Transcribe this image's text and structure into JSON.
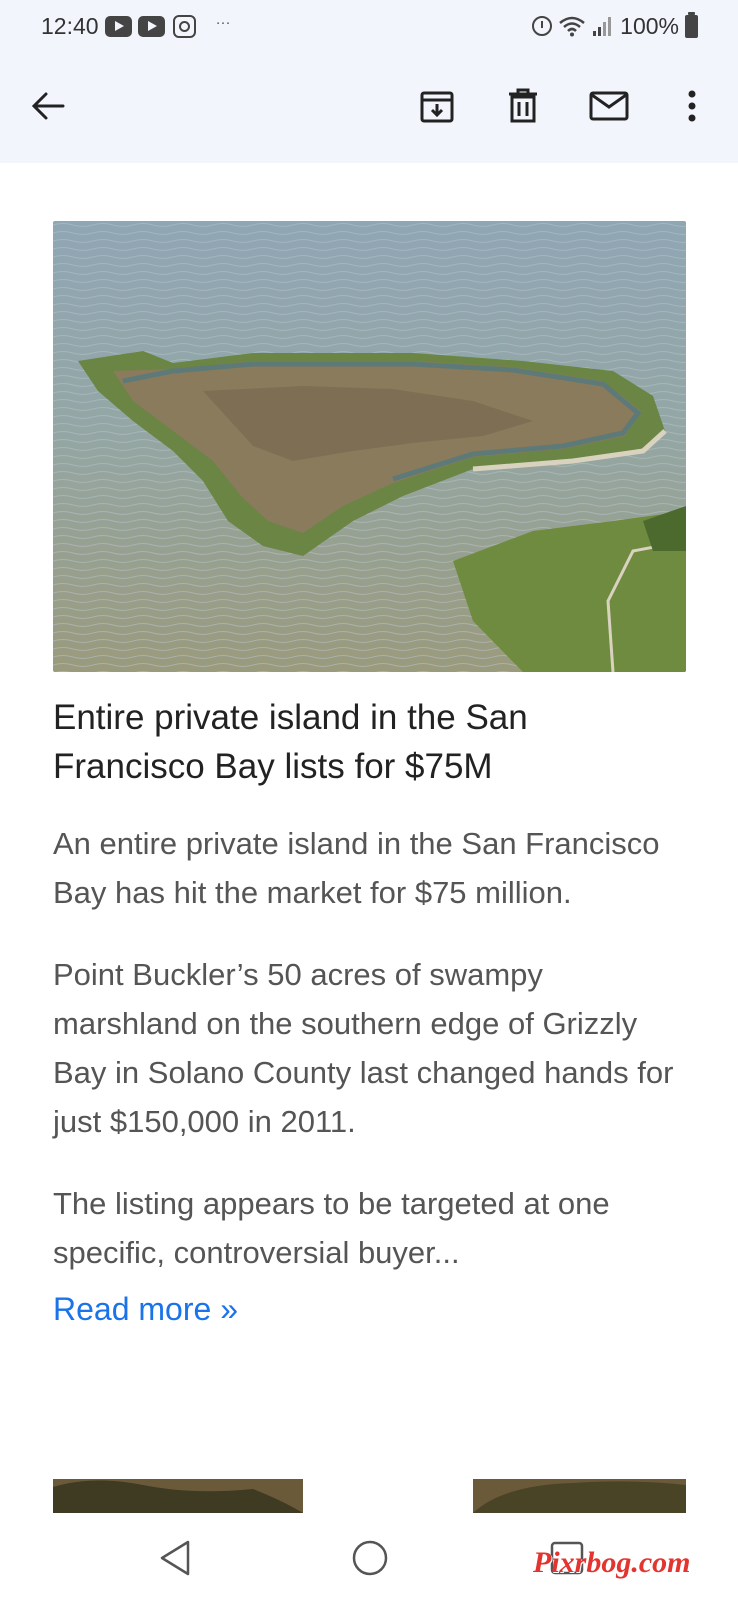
{
  "status_bar": {
    "time": "12:40",
    "more_indicator": "···",
    "battery": "100%",
    "icons": [
      "youtube-icon",
      "youtube-icon",
      "instagram-icon",
      "alarm-icon",
      "wifi-icon",
      "signal-icon",
      "battery-icon"
    ]
  },
  "toolbar": {
    "icons": [
      "back-arrow-icon",
      "archive-icon",
      "delete-icon",
      "mail-icon",
      "more-vert-icon"
    ]
  },
  "article": {
    "image_subject": "aerial view of marshy island in bay",
    "headline": "Entire private island in the San Francisco Bay lists for $75M",
    "paragraphs": [
      "An entire private island in the San Francisco Bay has hit the market for $75 million.",
      "Point Buckler’s 50 acres of swampy marshland on the southern edge of Grizzly Bay in Solano County last changed hands for just $150,000 in 2011.",
      "The listing appears to be targeted at one specific, controversial buyer..."
    ],
    "read_more": "Read more »"
  },
  "nav_bar": {
    "icons": [
      "nav-back-icon",
      "nav-home-icon",
      "nav-recents-icon"
    ]
  },
  "watermark": "Pixrbog.com",
  "colors": {
    "app_bar": "#f3f5fc",
    "link": "#1a73e8",
    "watermark": "#e3342f"
  }
}
